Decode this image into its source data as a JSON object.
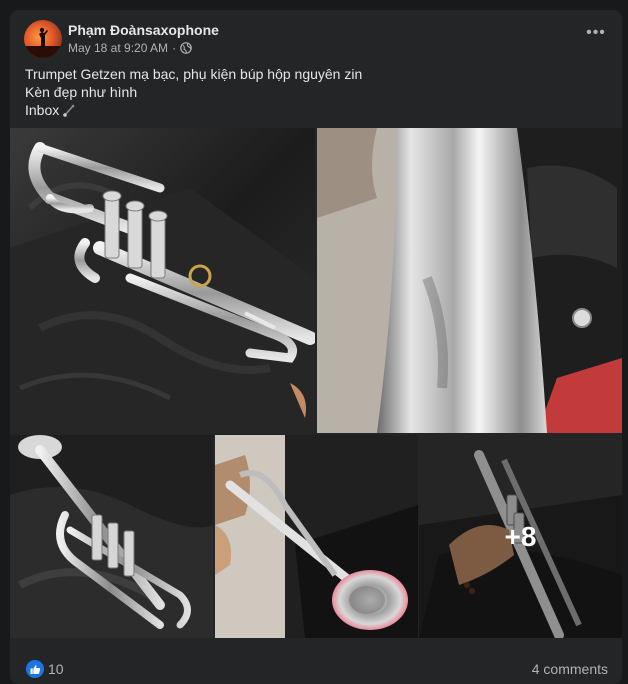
{
  "post": {
    "author": "Phạm Đoànsaxophone",
    "timestamp": "May 18 at 9:20 AM",
    "separator": "·",
    "privacy_icon": "globe-icon",
    "more_icon": "more-options-icon",
    "more_label": "•••",
    "caption": {
      "line1": "Trumpet Getzen mạ bạc, phụ kiện búp hộp nguyên zin",
      "line2": "Kèn đẹp như hình",
      "line3": "Inbox"
    },
    "photos": {
      "count_visible": 5,
      "more_overlay": "+8"
    },
    "reactions": {
      "icon": "like-icon",
      "count": "10"
    },
    "comments_label": "4 comments",
    "colors": {
      "background": "#18191a",
      "card": "#242526",
      "primary_text": "#e4e6eb",
      "secondary_text": "#b0b3b8",
      "like_blue": "#1b74e4"
    }
  }
}
